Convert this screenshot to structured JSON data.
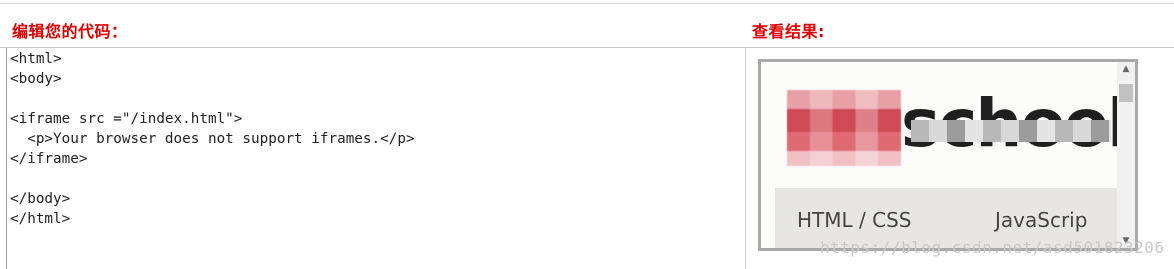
{
  "headings": {
    "edit_code": "编辑您的代码：",
    "view_result": "查看结果:"
  },
  "editor": {
    "code": "<html>\n<body>\n\n<iframe src =\"/index.html\">\n  <p>Your browser does not support iframes.</p>\n</iframe>\n\n</body>\n</html>"
  },
  "preview": {
    "logo_text": "school",
    "nav_items": [
      "HTML / CSS",
      "JavaScrip"
    ],
    "scroll_up_icon": "triangle-up-icon",
    "scroll_down_icon": "triangle-down-icon"
  },
  "watermark": "https://blog.csdn.net/asd501823206",
  "colors": {
    "heading": "#e00000",
    "preview_border": "#a9a9a9",
    "nav_background": "#e8e6e2"
  }
}
